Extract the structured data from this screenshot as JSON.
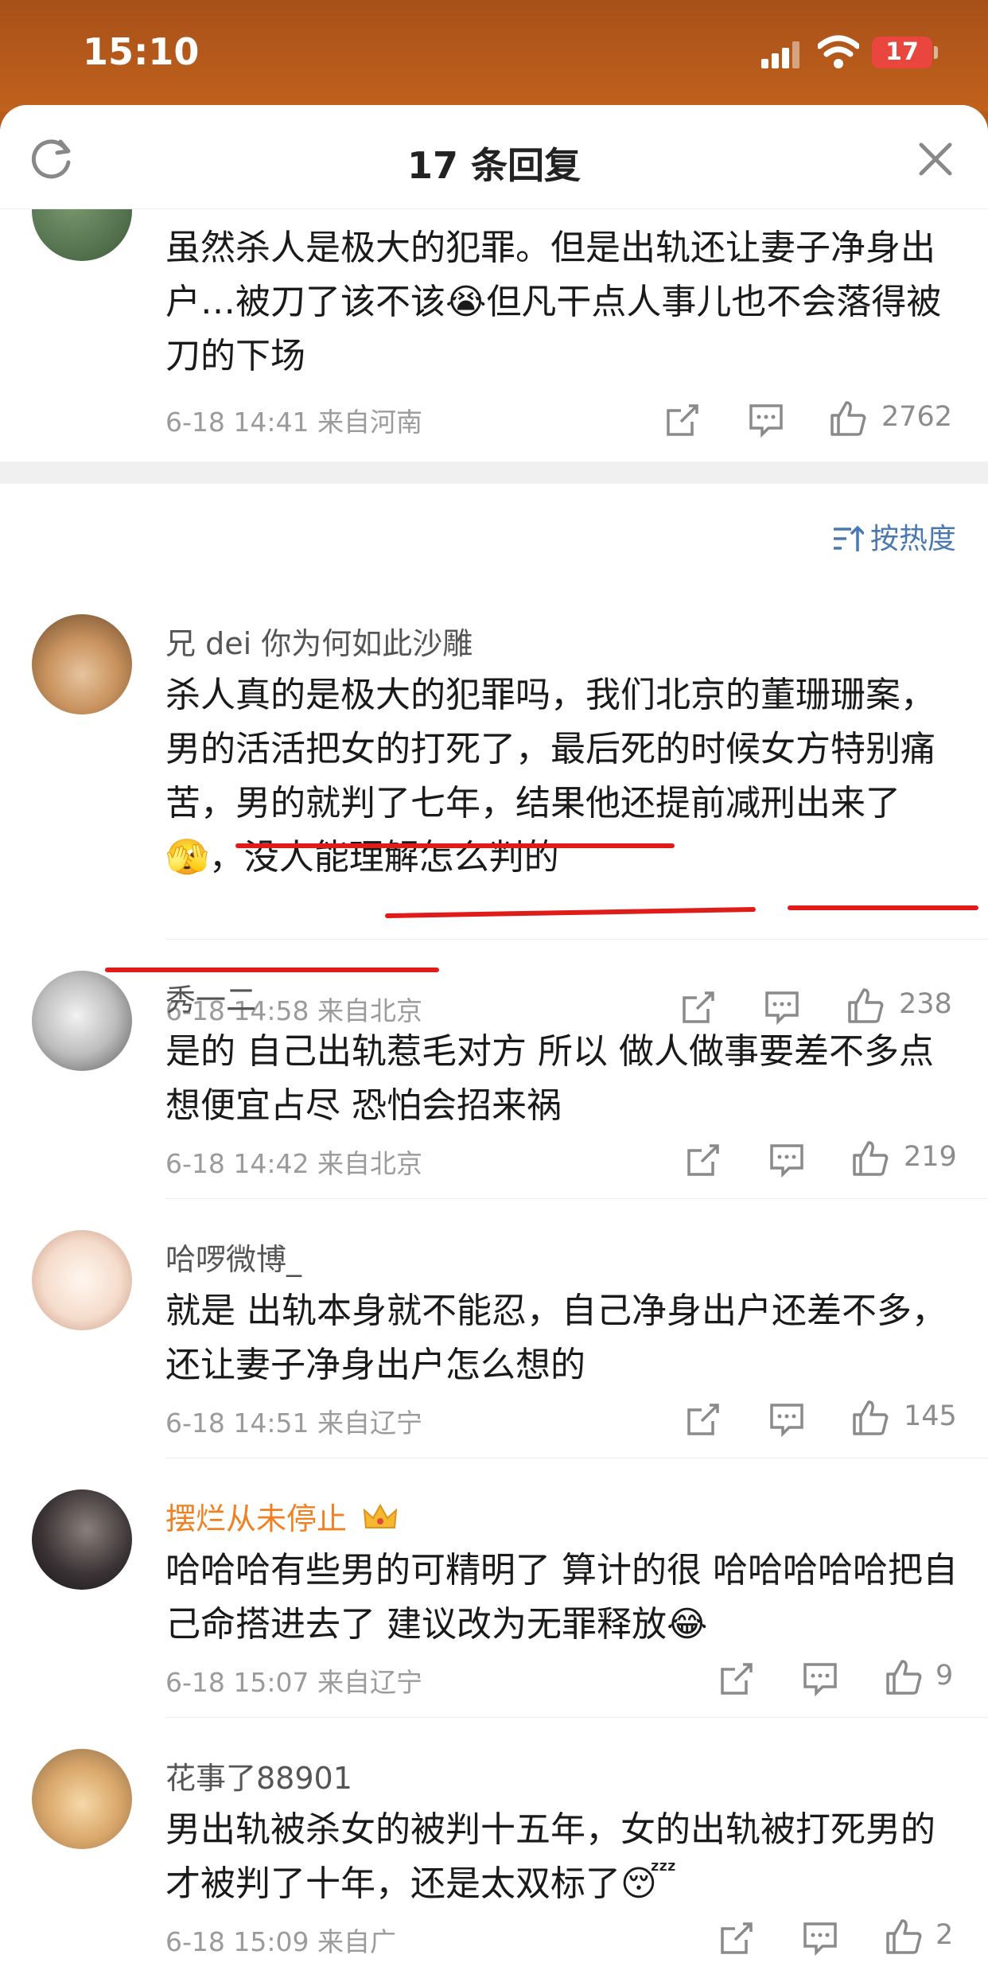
{
  "status_bar": {
    "time": "15:10",
    "battery": "17"
  },
  "header": {
    "title": "17 条回复"
  },
  "sort_label": "按热度",
  "comments": [
    {
      "username": "",
      "text": "虽然杀人是极大的犯罪。但是出轨还让妻子净身出户…被刀了该不该😭但凡干点人事儿也不会落得被刀的下场",
      "meta": "6-18 14:41 来自河南",
      "likes": "2762"
    },
    {
      "username": "兄 dei 你为何如此沙雕",
      "text": "杀人真的是极大的犯罪吗，我们北京的董珊珊案，男的活活把女的打死了，最后死的时候女方特别痛苦，男的就判了七年，结果他还提前减刑出来了🫣，没人能理解怎么判的",
      "meta": "6-18 14:58 来自北京",
      "likes": "238"
    },
    {
      "username": "秀一二",
      "text": "是的 自己出轨惹毛对方 所以 做人做事要差不多点  想便宜占尽 恐怕会招来祸",
      "meta": "6-18 14:42 来自北京",
      "likes": "219"
    },
    {
      "username": "哈啰微博_",
      "text": "就是 出轨本身就不能忍，自己净身出户还差不多，还让妻子净身出户怎么想的",
      "meta": "6-18 14:51 来自辽宁",
      "likes": "145"
    },
    {
      "username": "摆烂从未停止",
      "text": "哈哈哈有些男的可精明了 算计的很 哈哈哈哈哈把自己命搭进去了  建议改为无罪释放😂",
      "meta": "6-18 15:07 来自辽宁",
      "likes": "9"
    },
    {
      "username": "花事了88901",
      "text": "男出轨被杀女的被判十五年，女的出轨被打死男的才被判了十年，还是太双标了😴",
      "meta": "6-18 15:09 来自广",
      "likes": "2"
    }
  ],
  "colors": {
    "accent_blue": "#4a78b0",
    "username_orange": "#f08021",
    "underline_red": "#e11a1a"
  }
}
